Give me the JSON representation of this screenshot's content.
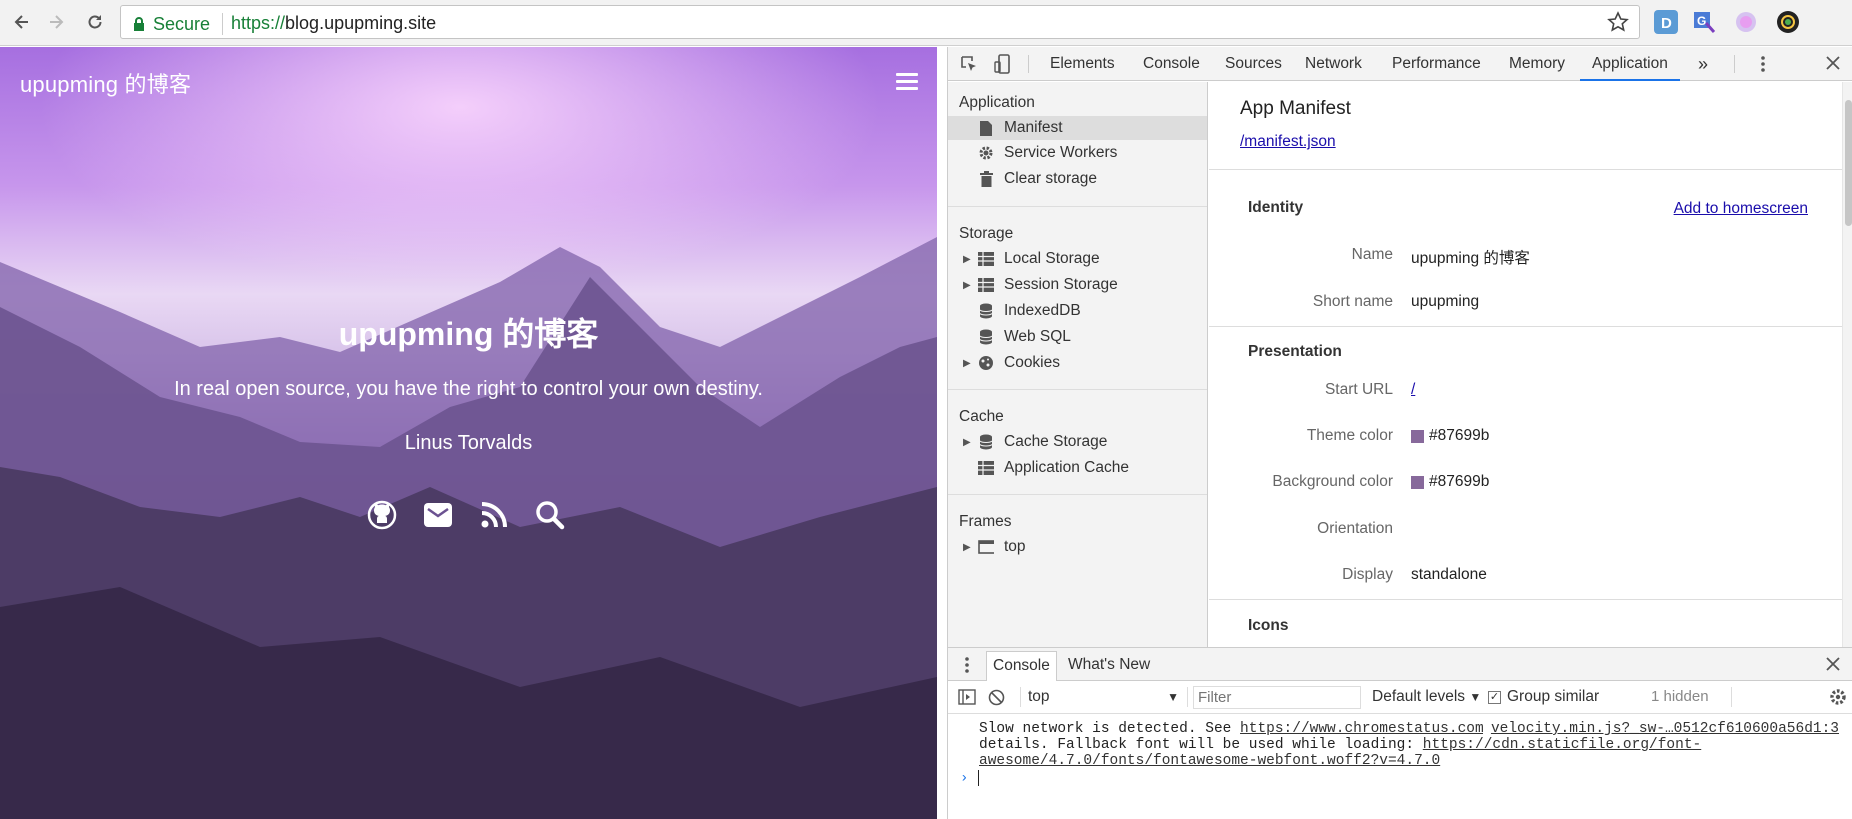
{
  "browser": {
    "secure_label": "Secure",
    "url_scheme": "https://",
    "url_rest": "blog.upupming.site"
  },
  "page": {
    "site_title": "upupming 的博客",
    "hero_title": "upupming 的博客",
    "quote": "In real open source, you have the right to control your own destiny.",
    "author": "Linus Torvalds",
    "icons": [
      "github-icon",
      "mail-icon",
      "rss-icon",
      "search-icon"
    ]
  },
  "devtools": {
    "tabs": [
      "Elements",
      "Console",
      "Sources",
      "Network",
      "Performance",
      "Memory",
      "Application"
    ],
    "active_tab": "Application",
    "more_tabs": "»",
    "sidebar": {
      "application_header": "Application",
      "application_items": [
        "Manifest",
        "Service Workers",
        "Clear storage"
      ],
      "storage_header": "Storage",
      "storage_items": [
        "Local Storage",
        "Session Storage",
        "IndexedDB",
        "Web SQL",
        "Cookies"
      ],
      "cache_header": "Cache",
      "cache_items": [
        "Cache Storage",
        "Application Cache"
      ],
      "frames_header": "Frames",
      "frames_items": [
        "top"
      ]
    },
    "manifest": {
      "title": "App Manifest",
      "link": "/manifest.json",
      "identity_header": "Identity",
      "add_to_homescreen": "Add to homescreen",
      "name_key": "Name",
      "name_val": "upupming 的博客",
      "short_name_key": "Short name",
      "short_name_val": "upupming",
      "presentation_header": "Presentation",
      "start_url_key": "Start URL",
      "start_url_val": "/",
      "theme_color_key": "Theme color",
      "theme_color_val": "#87699b",
      "bg_color_key": "Background color",
      "bg_color_val": "#87699b",
      "orientation_key": "Orientation",
      "orientation_val": "",
      "display_key": "Display",
      "display_val": "standalone",
      "icons_header": "Icons"
    },
    "drawer": {
      "tabs": [
        "Console",
        "What's New"
      ],
      "context": "top",
      "filter_placeholder": "Filter",
      "levels": "Default levels",
      "group_similar": "Group similar",
      "hidden": "1 hidden",
      "msg_text1": "Slow network is detected. See ",
      "msg_link1": "https://www.chromestatus.com/feature/5636954674692096",
      "msg_text2": " for more details. Fallback font will be used while loading: ",
      "msg_link2": "https://cdn.staticfile.org/font-awesome/4.7.0/fonts/fontawesome-webfont.woff2?v=4.7.0",
      "msg_source": "velocity.min.js?_sw-…0512cf610600a56d1:3"
    }
  },
  "colors": {
    "accent": "#1a73e8",
    "swatch": "#87699b",
    "secure": "#188038"
  }
}
